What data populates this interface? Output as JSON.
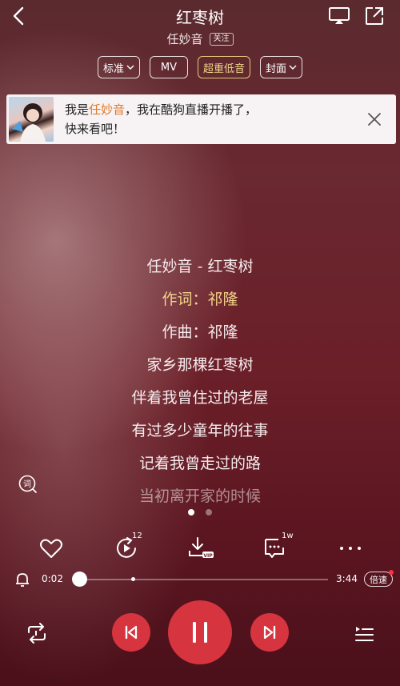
{
  "header": {
    "title": "红枣树",
    "artist": "任妙音",
    "follow_label": "关注"
  },
  "options": {
    "quality": "标准",
    "mv": "MV",
    "sound_effect": "超重低音",
    "cover": "封面"
  },
  "banner": {
    "prefix": "我是",
    "name": "任妙音",
    "suffix": "，我在酷狗直播开播了，",
    "line2": "快来看吧！"
  },
  "lyrics": [
    "任妙音 - 红枣树",
    "作词：祁隆",
    "作曲：祁隆",
    "家乡那棵红枣树",
    "伴着我曾住过的老屋",
    "有过多少童年的往事",
    "记着我曾走过的路",
    "当初离开家的时候"
  ],
  "pager": {
    "count": 2,
    "active_index": 0
  },
  "actions": {
    "comment_count": "12",
    "share_count": "1w"
  },
  "player": {
    "current_time": "0:02",
    "total_time": "3:44",
    "progress": 0.009,
    "speed_label": "倍速"
  },
  "colors": {
    "accent": "#d6343f",
    "lyric_active": "#f3d58a",
    "banner_highlight": "#e07a2a"
  }
}
